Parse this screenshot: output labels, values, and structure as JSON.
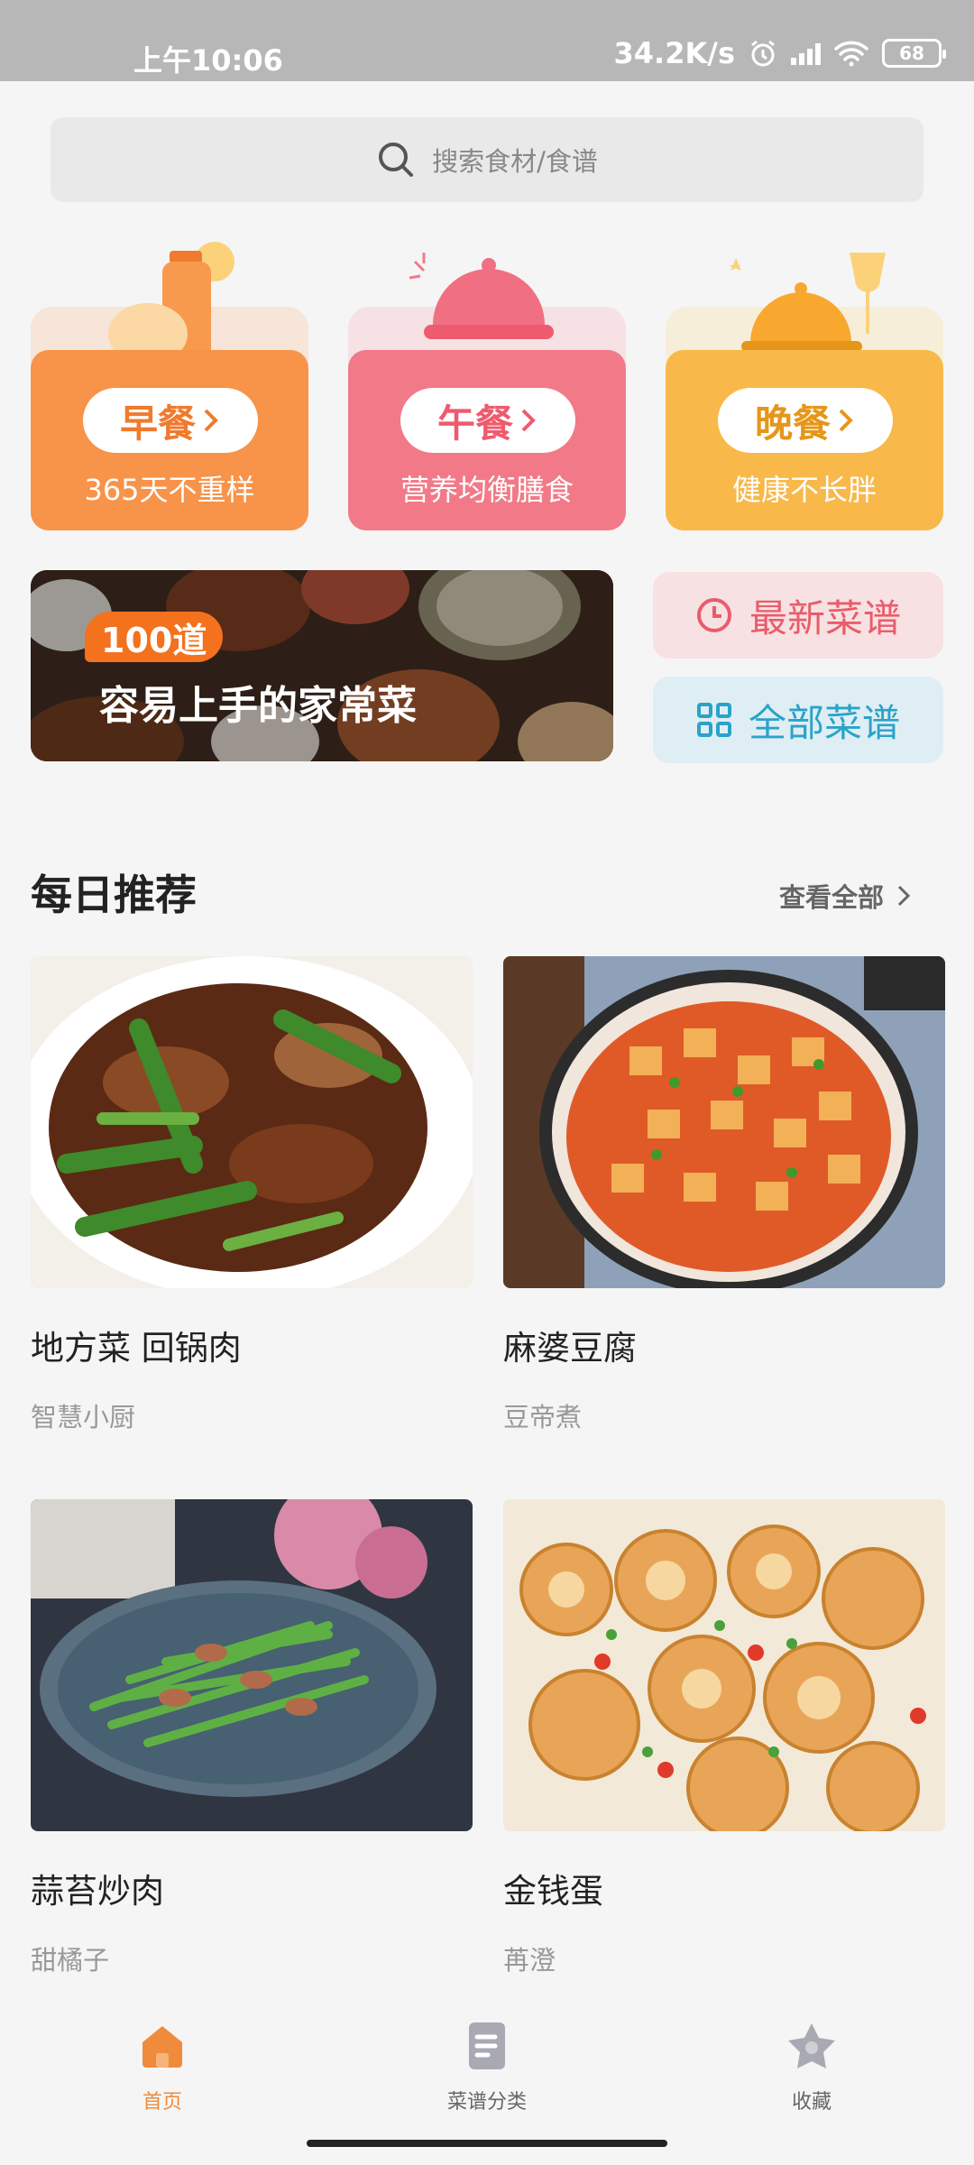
{
  "status_bar": {
    "time": "上午10:06",
    "net_speed": "34.2K/s",
    "battery": "68"
  },
  "search": {
    "placeholder": "搜索食材/食谱"
  },
  "meals": [
    {
      "label": "早餐",
      "subtitle": "365天不重样",
      "color": "#f8934a",
      "text_color": "#f07a2e"
    },
    {
      "label": "午餐",
      "subtitle": "营养均衡膳食",
      "color": "#f27a88",
      "text_color": "#ee5b6e"
    },
    {
      "label": "晚餐",
      "subtitle": "健康不长胖",
      "color": "#f8b84a",
      "text_color": "#e69619"
    }
  ],
  "banner": {
    "badge": "100道",
    "title": "容易上手的家常菜"
  },
  "quick_links": [
    {
      "label": "最新菜谱",
      "color": "#e85d6a",
      "bg": "#f7e1e3"
    },
    {
      "label": "全部菜谱",
      "color": "#2aa3c9",
      "bg": "#dfeef4"
    }
  ],
  "daily": {
    "title": "每日推荐",
    "see_all": "查看全部",
    "recipes": [
      {
        "name": "地方菜 回锅肉",
        "author": "智慧小厨"
      },
      {
        "name": "麻婆豆腐",
        "author": "豆帝煮"
      },
      {
        "name": "蒜苔炒肉",
        "author": "甜橘子"
      },
      {
        "name": "金钱蛋",
        "author": "苒澄"
      }
    ]
  },
  "tabs": [
    {
      "label": "首页"
    },
    {
      "label": "菜谱分类"
    },
    {
      "label": "收藏"
    }
  ],
  "colors": {
    "accent": "#f08a3c"
  }
}
